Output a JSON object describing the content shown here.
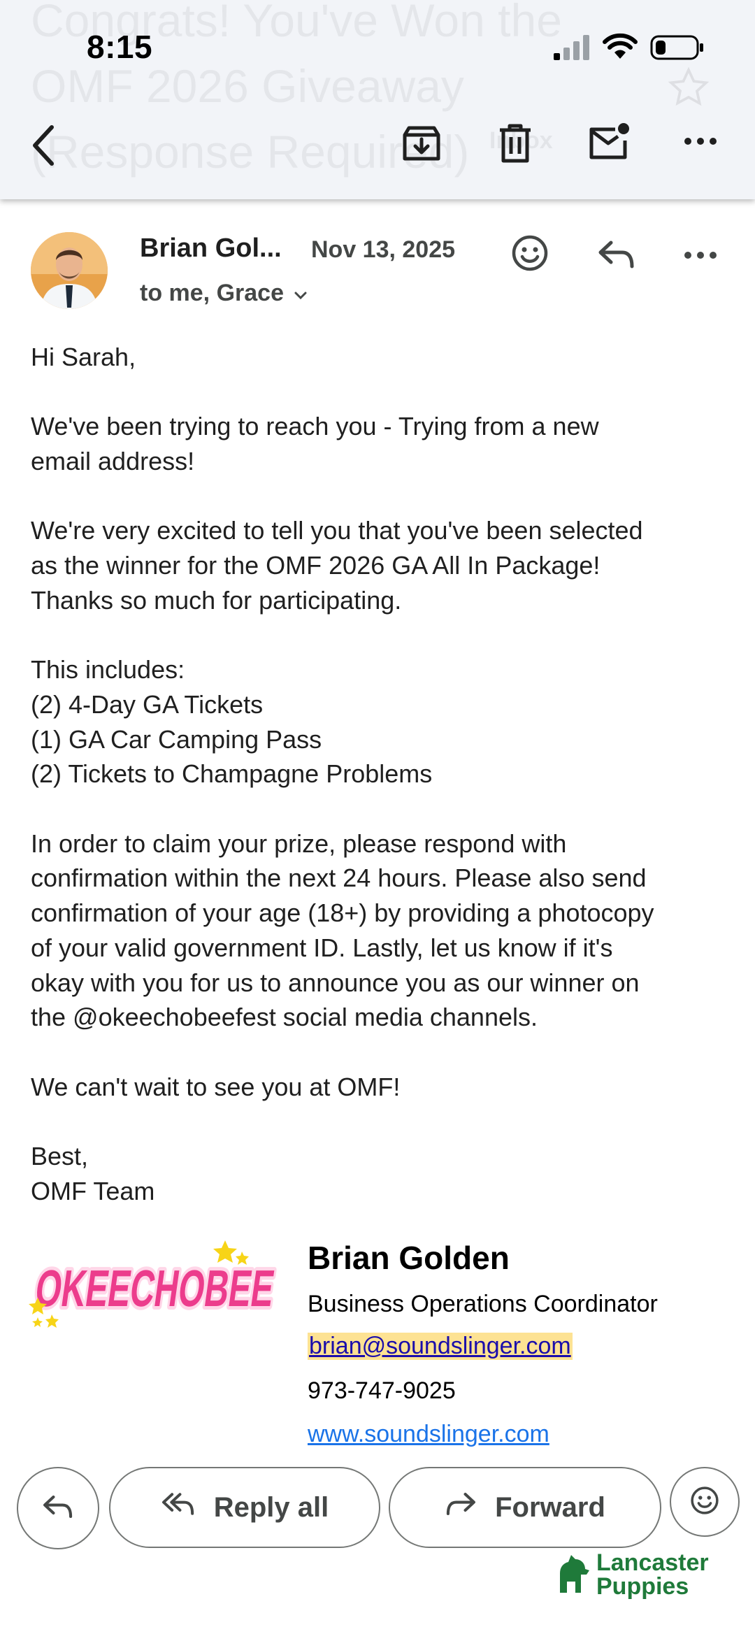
{
  "status_bar": {
    "time": "8:15"
  },
  "header": {
    "subject_ghost_lines": [
      "Congrats! You've Won the",
      "OMF 2026 Giveaway",
      "(Response Required)"
    ],
    "label_ghost": "Inbox"
  },
  "message": {
    "sender_name": "Brian Gol...",
    "date": "Nov 13, 2025",
    "recipients": "to me, Grace",
    "body": {
      "greeting": "Hi Sarah,",
      "p1": [
        "We've been trying to reach you - Trying from a new",
        "email address!"
      ],
      "p2": [
        "We're very excited to tell you that you've been selected",
        "as the winner for the OMF 2026 GA All In Package!",
        "Thanks so much for participating."
      ],
      "p3": [
        "This includes:",
        "(2) 4-Day GA Tickets",
        "(1) GA Car Camping Pass",
        "(2) Tickets to Champagne Problems"
      ],
      "p4": [
        "In order to claim your prize, please respond with",
        "confirmation within the next 24 hours. Please also send",
        "confirmation of your age (18+) by providing a photocopy",
        "of your valid government ID.  Lastly, let us know if it's",
        "okay with you for us to announce you as our winner on",
        "the @okeechobeefest social media channels."
      ],
      "p5": "We can't wait to see you at OMF!",
      "closing": [
        "Best,",
        "OMF Team"
      ]
    },
    "signature": {
      "logo_text": "OKEECHOBEE",
      "name": "Brian Golden",
      "title": "Business Operations Coordinator",
      "email": "brian@soundslinger.com",
      "phone": "973-747-9025",
      "website": "www.soundslinger.com"
    }
  },
  "actions": {
    "reply_all": "Reply all",
    "forward": "Forward"
  },
  "watermark": {
    "line1": "Lancaster",
    "line2": "Puppies"
  },
  "colors": {
    "header_bg": "#f2f4f8",
    "link": "#1a73e8",
    "highlight": "#fde293",
    "logo_pink": "#ec3c8c",
    "watermark_green": "#1f7a3a"
  }
}
